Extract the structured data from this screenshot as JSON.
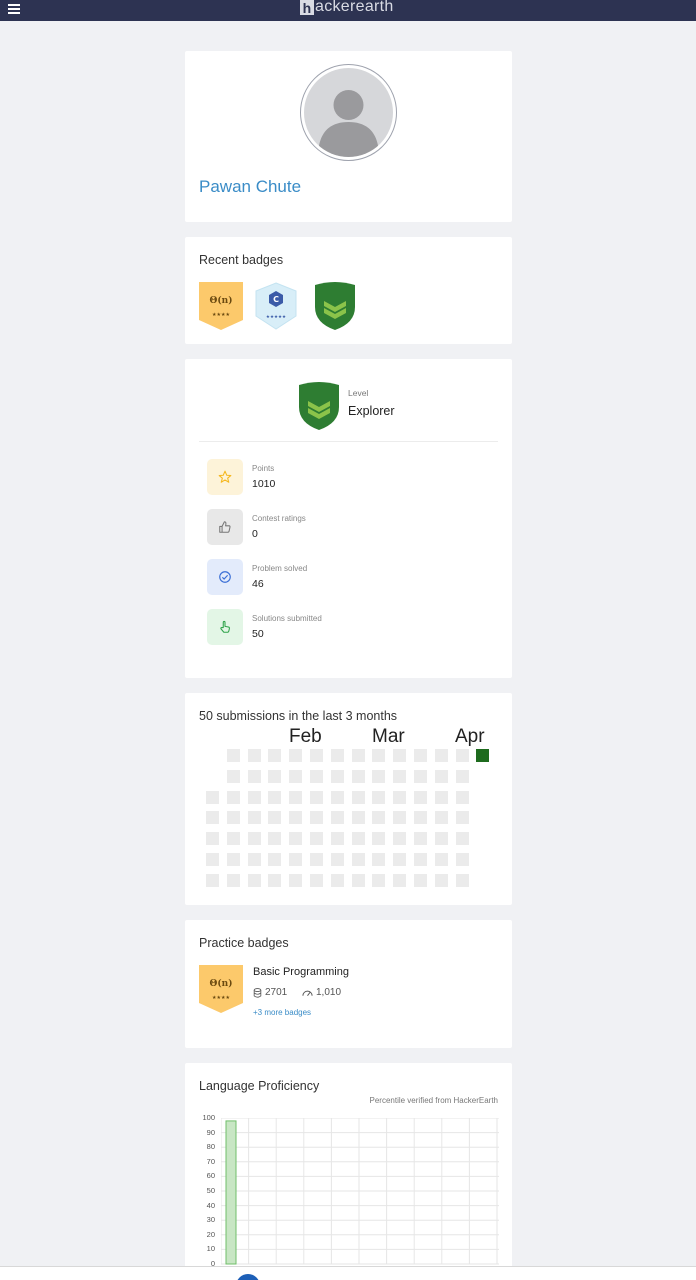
{
  "header": {
    "logo_letter": "h",
    "logo_rest": "ackerearth"
  },
  "profile": {
    "name": "Pawan Chute"
  },
  "recent_badges": {
    "title": "Recent badges",
    "items": [
      {
        "type": "complexity",
        "symbol": "Θ(n)",
        "stars": "★★★★",
        "color": "#fcc96b"
      },
      {
        "type": "language",
        "symbol": "C",
        "stars": "★★★★★",
        "color": "#d8eef8"
      },
      {
        "type": "level-shield",
        "color": "#2e7d32"
      }
    ]
  },
  "level": {
    "caption": "Level",
    "value": "Explorer",
    "stats": [
      {
        "label": "Points",
        "value": "1010",
        "icon": "star-icon",
        "bg": "#fdf3d9",
        "color": "#f5b820"
      },
      {
        "label": "Contest ratings",
        "value": "0",
        "icon": "thumbs-up-icon",
        "bg": "#e8e8e8",
        "color": "#777"
      },
      {
        "label": "Problem solved",
        "value": "46",
        "icon": "check-circle-icon",
        "bg": "#e3ebfb",
        "color": "#3b6fd6"
      },
      {
        "label": "Solutions submitted",
        "value": "50",
        "icon": "pointer-hand-icon",
        "bg": "#e3f6e6",
        "color": "#2fa34a"
      }
    ]
  },
  "submissions": {
    "title": "50 submissions in the last 3 months",
    "months": [
      "Feb",
      "Mar",
      "Apr"
    ],
    "active_color": "#1e6b1e",
    "empty_color": "#ebebeb"
  },
  "practice": {
    "title": "Practice badges",
    "badge_symbol": "Θ(n)",
    "badge_stars": "★★★★",
    "name": "Basic Programming",
    "count": "2701",
    "score": "1,010",
    "more": "+3 more badges"
  },
  "language": {
    "title": "Language Proficiency",
    "subtitle": "Percentile verified from HackerEarth",
    "y_ticks": [
      "100",
      "90",
      "80",
      "70",
      "60",
      "50",
      "40",
      "30",
      "20",
      "10",
      "0"
    ]
  },
  "chart_data": {
    "type": "bar",
    "categories": [
      ""
    ],
    "values": [
      98
    ],
    "ylim": [
      0,
      100
    ],
    "yticks": [
      0,
      10,
      20,
      30,
      40,
      50,
      60,
      70,
      80,
      90,
      100
    ],
    "grid": true,
    "bar_color": "#c8e6c4",
    "bar_border": "#6fbf6a"
  }
}
